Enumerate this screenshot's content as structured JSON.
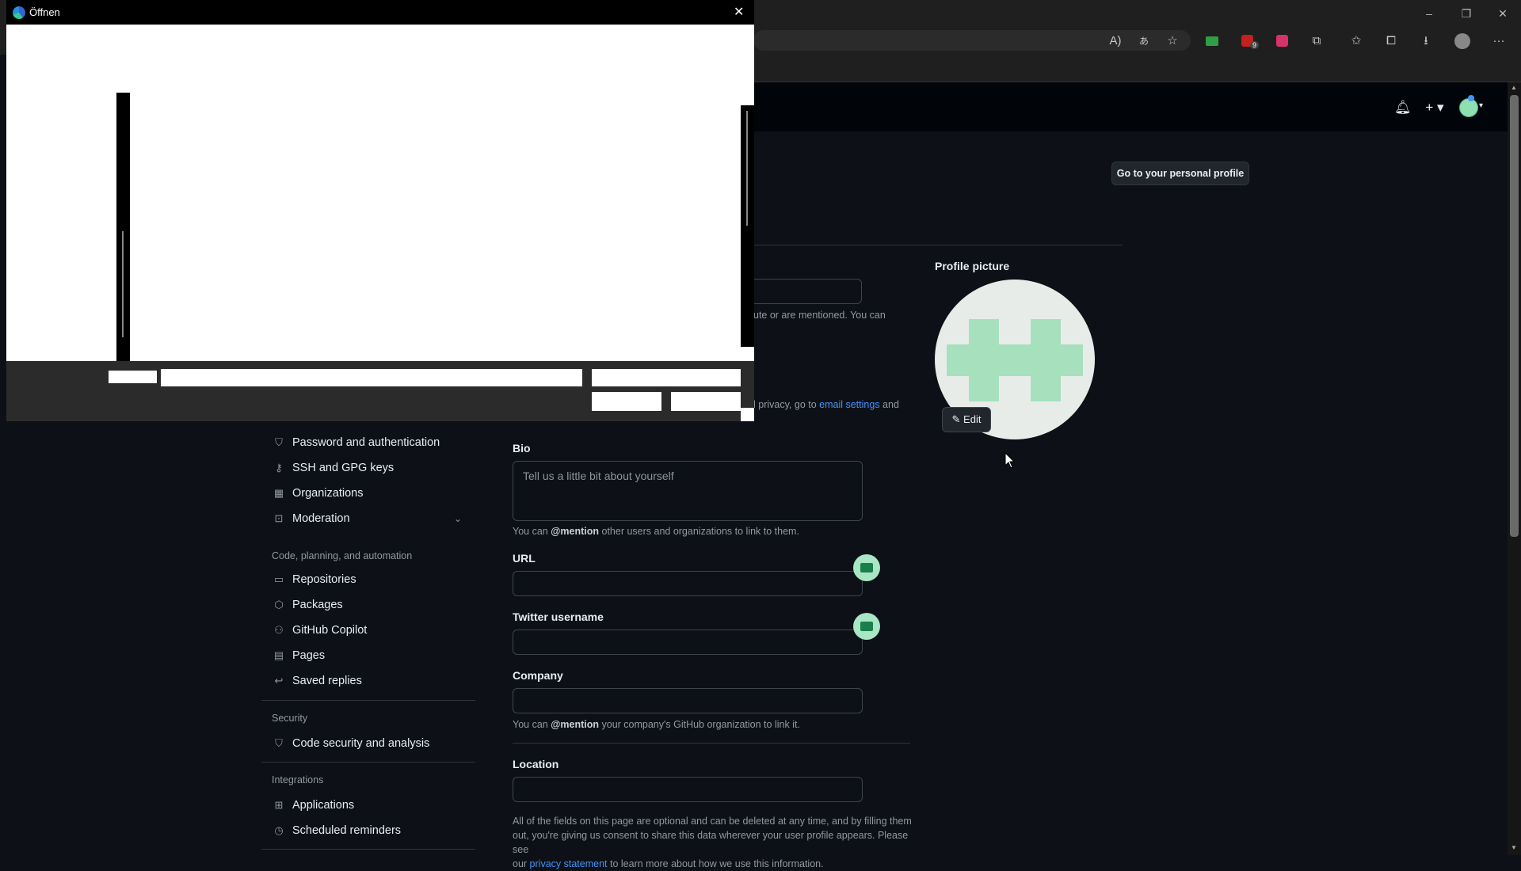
{
  "dialog": {
    "title": "Öffnen"
  },
  "browser": {
    "window_buttons": [
      "–",
      "❐",
      "✕"
    ],
    "toolbar_icons": [
      "read-aloud-icon",
      "translate-icon",
      "favorite-add-icon",
      "extension-green-icon",
      "ublock-icon",
      "ublock-badge",
      "mic-extension-icon",
      "extensions-icon",
      "favorites-icon",
      "collections-icon",
      "downloads-icon",
      "profile-icon",
      "more-icon"
    ],
    "ublock_badge": "9"
  },
  "github": {
    "go_to_profile": "Go to your personal profile",
    "profile_picture_label": "Profile picture",
    "edit_label": "Edit",
    "mention_note_fragment": "ute or are mentioned. You can",
    "email_note": {
      "before": "l privacy, go to ",
      "link": "email settings",
      "after": " and"
    },
    "sidebar": {
      "items_top": [
        {
          "icon": "shield-lock-icon",
          "label": "Password and authentication"
        },
        {
          "icon": "key-icon",
          "label": "SSH and GPG keys"
        },
        {
          "icon": "organization-icon",
          "label": "Organizations"
        },
        {
          "icon": "report-icon",
          "label": "Moderation"
        }
      ],
      "section_code": "Code, planning, and automation",
      "items_code": [
        {
          "icon": "repo-icon",
          "label": "Repositories"
        },
        {
          "icon": "package-icon",
          "label": "Packages"
        },
        {
          "icon": "copilot-icon",
          "label": "GitHub Copilot"
        },
        {
          "icon": "browser-icon",
          "label": "Pages"
        },
        {
          "icon": "reply-icon",
          "label": "Saved replies"
        }
      ],
      "section_security": "Security",
      "items_security": [
        {
          "icon": "shield-icon",
          "label": "Code security and analysis"
        }
      ],
      "section_integrations": "Integrations",
      "items_integrations": [
        {
          "icon": "apps-icon",
          "label": "Applications"
        },
        {
          "icon": "clock-icon",
          "label": "Scheduled reminders"
        }
      ]
    },
    "form": {
      "bio_label": "Bio",
      "bio_placeholder": "Tell us a little bit about yourself",
      "bio_note_pre": "You can ",
      "bio_note_bold": "@mention",
      "bio_note_post": " other users and organizations to link to them.",
      "url_label": "URL",
      "url_value": "",
      "twitter_label": "Twitter username",
      "twitter_value": "",
      "company_label": "Company",
      "company_value": "",
      "company_note_pre": "You can ",
      "company_note_bold": "@mention",
      "company_note_post": " your company's GitHub organization to link it.",
      "location_label": "Location",
      "location_value": "",
      "footer_line1": "All of the fields on this page are optional and can be deleted at any time, and by filling them",
      "footer_line2": "out, you're giving us consent to share this data wherever your user profile appears. Please see",
      "footer_pre": "our ",
      "footer_link": "privacy statement",
      "footer_post": " to learn more about how we use this information."
    }
  }
}
